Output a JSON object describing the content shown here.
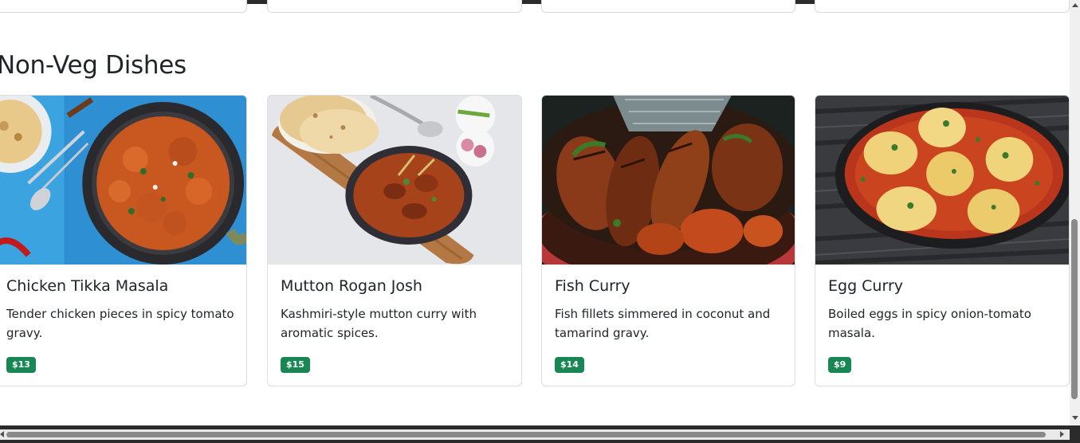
{
  "section": {
    "title": "Non-Veg Dishes"
  },
  "dishes": [
    {
      "name": "Chicken Tikka Masala",
      "description": "Tender chicken pieces in spicy tomato gravy.",
      "price": "$13",
      "image_icon": "chicken-tikka-masala-photo"
    },
    {
      "name": "Mutton Rogan Josh",
      "description": "Kashmiri-style mutton curry with aromatic spices.",
      "price": "$15",
      "image_icon": "mutton-rogan-josh-photo"
    },
    {
      "name": "Fish Curry",
      "description": "Fish fillets simmered in coconut and tamarind gravy.",
      "price": "$14",
      "image_icon": "fish-curry-photo"
    },
    {
      "name": "Egg Curry",
      "description": "Boiled eggs in spicy onion-tomato masala.",
      "price": "$9",
      "image_icon": "egg-curry-photo"
    }
  ],
  "colors": {
    "price_badge": "#198754",
    "text": "#212529",
    "card_border": "#dcdcdc"
  }
}
